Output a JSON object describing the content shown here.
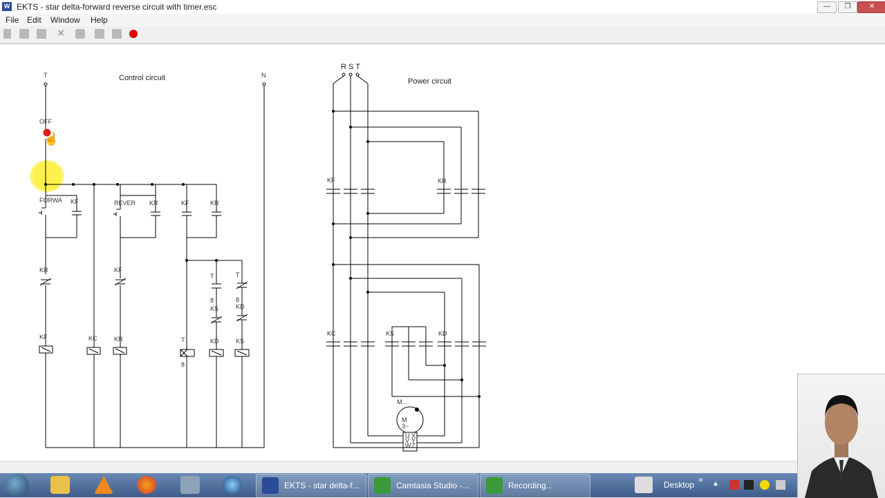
{
  "window": {
    "title": "EKTS - star delta-forward reverse circuit with timer.esc",
    "app_icon": "ekts-app-icon",
    "controls": [
      "minimize",
      "maximize",
      "close"
    ]
  },
  "menu": {
    "items": [
      {
        "label": "File"
      },
      {
        "label": "Edit"
      },
      {
        "label": "Window"
      },
      {
        "label": "Help"
      }
    ]
  },
  "toolbar": {
    "buttons": [
      "new-icon",
      "open-icon",
      "save-icon",
      "delete-icon",
      "print-icon",
      "grid-icon",
      "stop-icon",
      "record-icon"
    ],
    "record_color": "#e00000"
  },
  "diagram": {
    "control": {
      "title": "Control circuit",
      "terminal_t": "T",
      "terminal_n": "N",
      "off_label": "OFF",
      "forward_label": "FORWA",
      "reverse_label": "REVER",
      "labels": {
        "kr_a": "KR",
        "kf_seal": "KF",
        "kf_b": "KF",
        "kr_seal": "KR",
        "kf_c": "KF",
        "kr_c": "KR",
        "t1": "T",
        "t2": "T",
        "s1": "8",
        "s2": "8",
        "ks1": "KS",
        "kd1": "KD",
        "coil_kf": "KF",
        "coil_kc": "KC",
        "coil_kr": "KR",
        "coil_t": "T",
        "coil_t_val": "8",
        "coil_kd": "KD",
        "coil_ks": "KS"
      }
    },
    "power": {
      "title": "Power circuit",
      "phases": "R S T",
      "labels": {
        "kf": "KF",
        "kr": "KR",
        "kc": "KC",
        "ks": "KS",
        "kd": "KD",
        "motor": "M...",
        "motor_symbol": "M\n3~",
        "windings": [
          "U",
          "V",
          "W",
          "X",
          "Y",
          "Z"
        ]
      }
    }
  },
  "taskbar": {
    "tasks": [
      {
        "label": "EKTS - star delta-f...",
        "icon": "ekts-icon"
      },
      {
        "label": "Camtasia Studio -...",
        "icon": "camtasia-icon"
      },
      {
        "label": "Recording...",
        "icon": "camtasia-recorder-icon"
      }
    ],
    "pinned": [
      "explorer-icon",
      "vlc-icon",
      "firefox-icon",
      "calculator-icon",
      "globe-icon"
    ],
    "tray_label": "Desktop",
    "tray_chevron": "»"
  }
}
